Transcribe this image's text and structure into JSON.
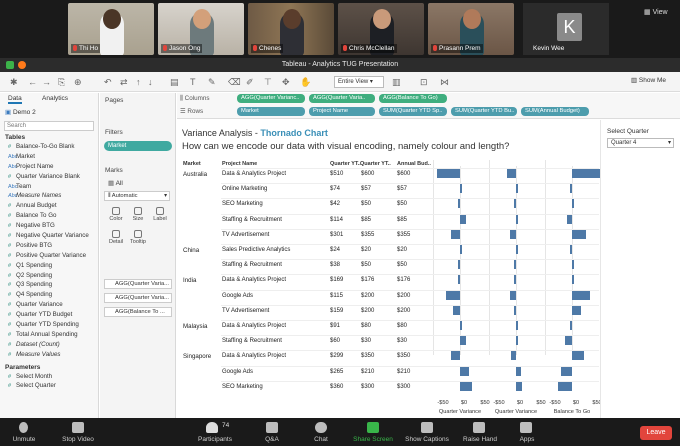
{
  "participants": [
    {
      "name": "Thi Ho",
      "muted": false
    },
    {
      "name": "Jason Ong",
      "muted": true
    },
    {
      "name": "Chenes",
      "muted": true
    },
    {
      "name": "Chris McClellan",
      "muted": true
    },
    {
      "name": "Prasann Prem",
      "muted": true
    },
    {
      "name": "Kevin Wee",
      "muted": false
    }
  ],
  "avatar_letter": "K",
  "view_label": "View",
  "window_title": "Tableau - Analytics TUG Presentation",
  "toolbar": {
    "fit": "Entire View",
    "show_me": "Show Me"
  },
  "data_pane": {
    "tabs": [
      "Data",
      "Analytics"
    ],
    "datasource": "Demo 2",
    "search_placeholder": "Search",
    "tables_label": "Tables",
    "fields": [
      {
        "name": "Balance-To-Go Blank",
        "type": "measure",
        "italic": false
      },
      {
        "name": "Market",
        "type": "dimension",
        "italic": false
      },
      {
        "name": "Project Name",
        "type": "dimension",
        "italic": false
      },
      {
        "name": "Quarter Variance Blank",
        "type": "measure",
        "italic": false
      },
      {
        "name": "Team",
        "type": "dimension",
        "italic": false
      },
      {
        "name": "Measure Names",
        "type": "dimension",
        "italic": true
      },
      {
        "name": "Annual Budget",
        "type": "measure",
        "italic": false
      },
      {
        "name": "Balance To Go",
        "type": "measure",
        "italic": false
      },
      {
        "name": "Negative BTG",
        "type": "measure",
        "italic": false
      },
      {
        "name": "Negative Quarter Variance",
        "type": "measure",
        "italic": false
      },
      {
        "name": "Positive BTG",
        "type": "measure",
        "italic": false
      },
      {
        "name": "Positive Quarter Variance",
        "type": "measure",
        "italic": false
      },
      {
        "name": "Q1 Spending",
        "type": "measure",
        "italic": false
      },
      {
        "name": "Q2 Spending",
        "type": "measure",
        "italic": false
      },
      {
        "name": "Q3 Spending",
        "type": "measure",
        "italic": false
      },
      {
        "name": "Q4 Spending",
        "type": "measure",
        "italic": false
      },
      {
        "name": "Quarter Variance",
        "type": "measure",
        "italic": false
      },
      {
        "name": "Quarter YTD Budget",
        "type": "measure",
        "italic": false
      },
      {
        "name": "Quarter YTD Spending",
        "type": "measure",
        "italic": false
      },
      {
        "name": "Total Annual Spending",
        "type": "measure",
        "italic": false
      },
      {
        "name": "Dataset (Count)",
        "type": "measure",
        "italic": true
      },
      {
        "name": "Measure Values",
        "type": "measure",
        "italic": true
      }
    ],
    "parameters_label": "Parameters",
    "parameters": [
      "Select Month",
      "Select Quarter"
    ]
  },
  "pages_label": "Pages",
  "filters_label": "Filters",
  "filter_pill": "Market",
  "marks": {
    "label": "Marks",
    "all": "All",
    "type": "Automatic",
    "buttons": [
      "Color",
      "Size",
      "Label",
      "Detail",
      "Tooltip"
    ],
    "pills": [
      "AGG(Quarter Varia...",
      "AGG(Quarter Varia...",
      "AGG(Balance To ..."
    ]
  },
  "shelves": {
    "columns_label": "Columns",
    "rows_label": "Rows",
    "columns": [
      "AGG(Quarter Varianc..",
      "AGG(Quarter Varia..",
      "AGG(Balance To Go)"
    ],
    "rows": [
      "Market",
      "Project Name",
      "SUM(Quarter YTD Sp..",
      "SUM(Quarter YTD Bu..",
      "SUM(Annual Budget)"
    ]
  },
  "sheet": {
    "title_prefix": "Variance Analysis - ",
    "title_highlight": "Thornado Chart",
    "subtitle": "How can we encode our data with visual encoding, namely colour and length?"
  },
  "chart_data": {
    "type": "bar",
    "headers": [
      "Market",
      "Project Name",
      "Quarter YT..",
      "Quarter YT..",
      "Annual Bud.."
    ],
    "rows": [
      {
        "market": "Australia",
        "project": "Data & Analytics Project",
        "qytd_spend": "$510",
        "qytd_budget": "$600",
        "annual": "$600",
        "qv": -50,
        "qv2": -20,
        "btg": 70
      },
      {
        "market": "",
        "project": "Online Marketing",
        "qytd_spend": "$74",
        "qytd_budget": "$57",
        "annual": "$57",
        "qv": 5,
        "qv2": 3,
        "btg": -5
      },
      {
        "market": "",
        "project": "SEO Marketing",
        "qytd_spend": "$42",
        "qytd_budget": "$50",
        "annual": "$50",
        "qv": -5,
        "qv2": -3,
        "btg": 5
      },
      {
        "market": "",
        "project": "Staffing & Recruitment",
        "qytd_spend": "$114",
        "qytd_budget": "$85",
        "annual": "$85",
        "qv": 12,
        "qv2": 5,
        "btg": -10
      },
      {
        "market": "",
        "project": "TV Advertisement",
        "qytd_spend": "$301",
        "qytd_budget": "$355",
        "annual": "$355",
        "qv": -20,
        "qv2": -12,
        "btg": 30
      },
      {
        "market": "China",
        "project": "Sales Predictive Analytics",
        "qytd_spend": "$24",
        "qytd_budget": "$20",
        "annual": "$20",
        "qv": 2,
        "qv2": 1,
        "btg": -2
      },
      {
        "market": "",
        "project": "Staffing & Recruitment",
        "qytd_spend": "$38",
        "qytd_budget": "$50",
        "annual": "$50",
        "qv": -4,
        "qv2": -2,
        "btg": 5
      },
      {
        "market": "India",
        "project": "Data & Analytics Project",
        "qytd_spend": "$169",
        "qytd_budget": "$176",
        "annual": "$176",
        "qv": -3,
        "qv2": -2,
        "btg": 3
      },
      {
        "market": "",
        "project": "Google Ads",
        "qytd_spend": "$115",
        "qytd_budget": "$200",
        "annual": "$200",
        "qv": -30,
        "qv2": -12,
        "btg": 40
      },
      {
        "market": "",
        "project": "TV Advertisement",
        "qytd_spend": "$159",
        "qytd_budget": "$200",
        "annual": "$200",
        "qv": -15,
        "qv2": -5,
        "btg": 20
      },
      {
        "market": "Malaysia",
        "project": "Data & Analytics Project",
        "qytd_spend": "$91",
        "qytd_budget": "$80",
        "annual": "$80",
        "qv": 5,
        "qv2": 2,
        "btg": -5
      },
      {
        "market": "",
        "project": "Staffing & Recruitment",
        "qytd_spend": "$60",
        "qytd_budget": "$30",
        "annual": "$30",
        "qv": 12,
        "qv2": 5,
        "btg": -15
      },
      {
        "market": "Singapore",
        "project": "Data & Analytics Project",
        "qytd_spend": "$299",
        "qytd_budget": "$350",
        "annual": "$350",
        "qv": -20,
        "qv2": -10,
        "btg": 25
      },
      {
        "market": "",
        "project": "Google Ads",
        "qytd_spend": "$265",
        "qytd_budget": "$210",
        "annual": "$210",
        "qv": 20,
        "qv2": 10,
        "btg": -25
      },
      {
        "market": "",
        "project": "SEO Marketing",
        "qytd_spend": "$360",
        "qytd_budget": "$300",
        "annual": "$300",
        "qv": 25,
        "qv2": 12,
        "btg": -30
      }
    ],
    "axes": [
      {
        "title": "Quarter Variance",
        "ticks": [
          "-$50",
          "$0",
          "$50"
        ],
        "range": [
          -50,
          50
        ]
      },
      {
        "title": "Quarter Variance",
        "ticks": [
          "-$50",
          "$0",
          "$50"
        ],
        "range": [
          -50,
          50
        ]
      },
      {
        "title": "Balance To Go",
        "ticks": [
          "-$50",
          "$0",
          "$50"
        ],
        "range": [
          -50,
          50
        ]
      }
    ]
  },
  "right_panel": {
    "label": "Select Quarter",
    "value": "Quarter 4"
  },
  "zoom_bar": {
    "items": [
      "Unmute",
      "Stop Video",
      "Participants",
      "Q&A",
      "Chat",
      "Share Screen",
      "Show Captions",
      "Raise Hand",
      "Apps"
    ],
    "participant_count": "74",
    "leave": "Leave"
  }
}
